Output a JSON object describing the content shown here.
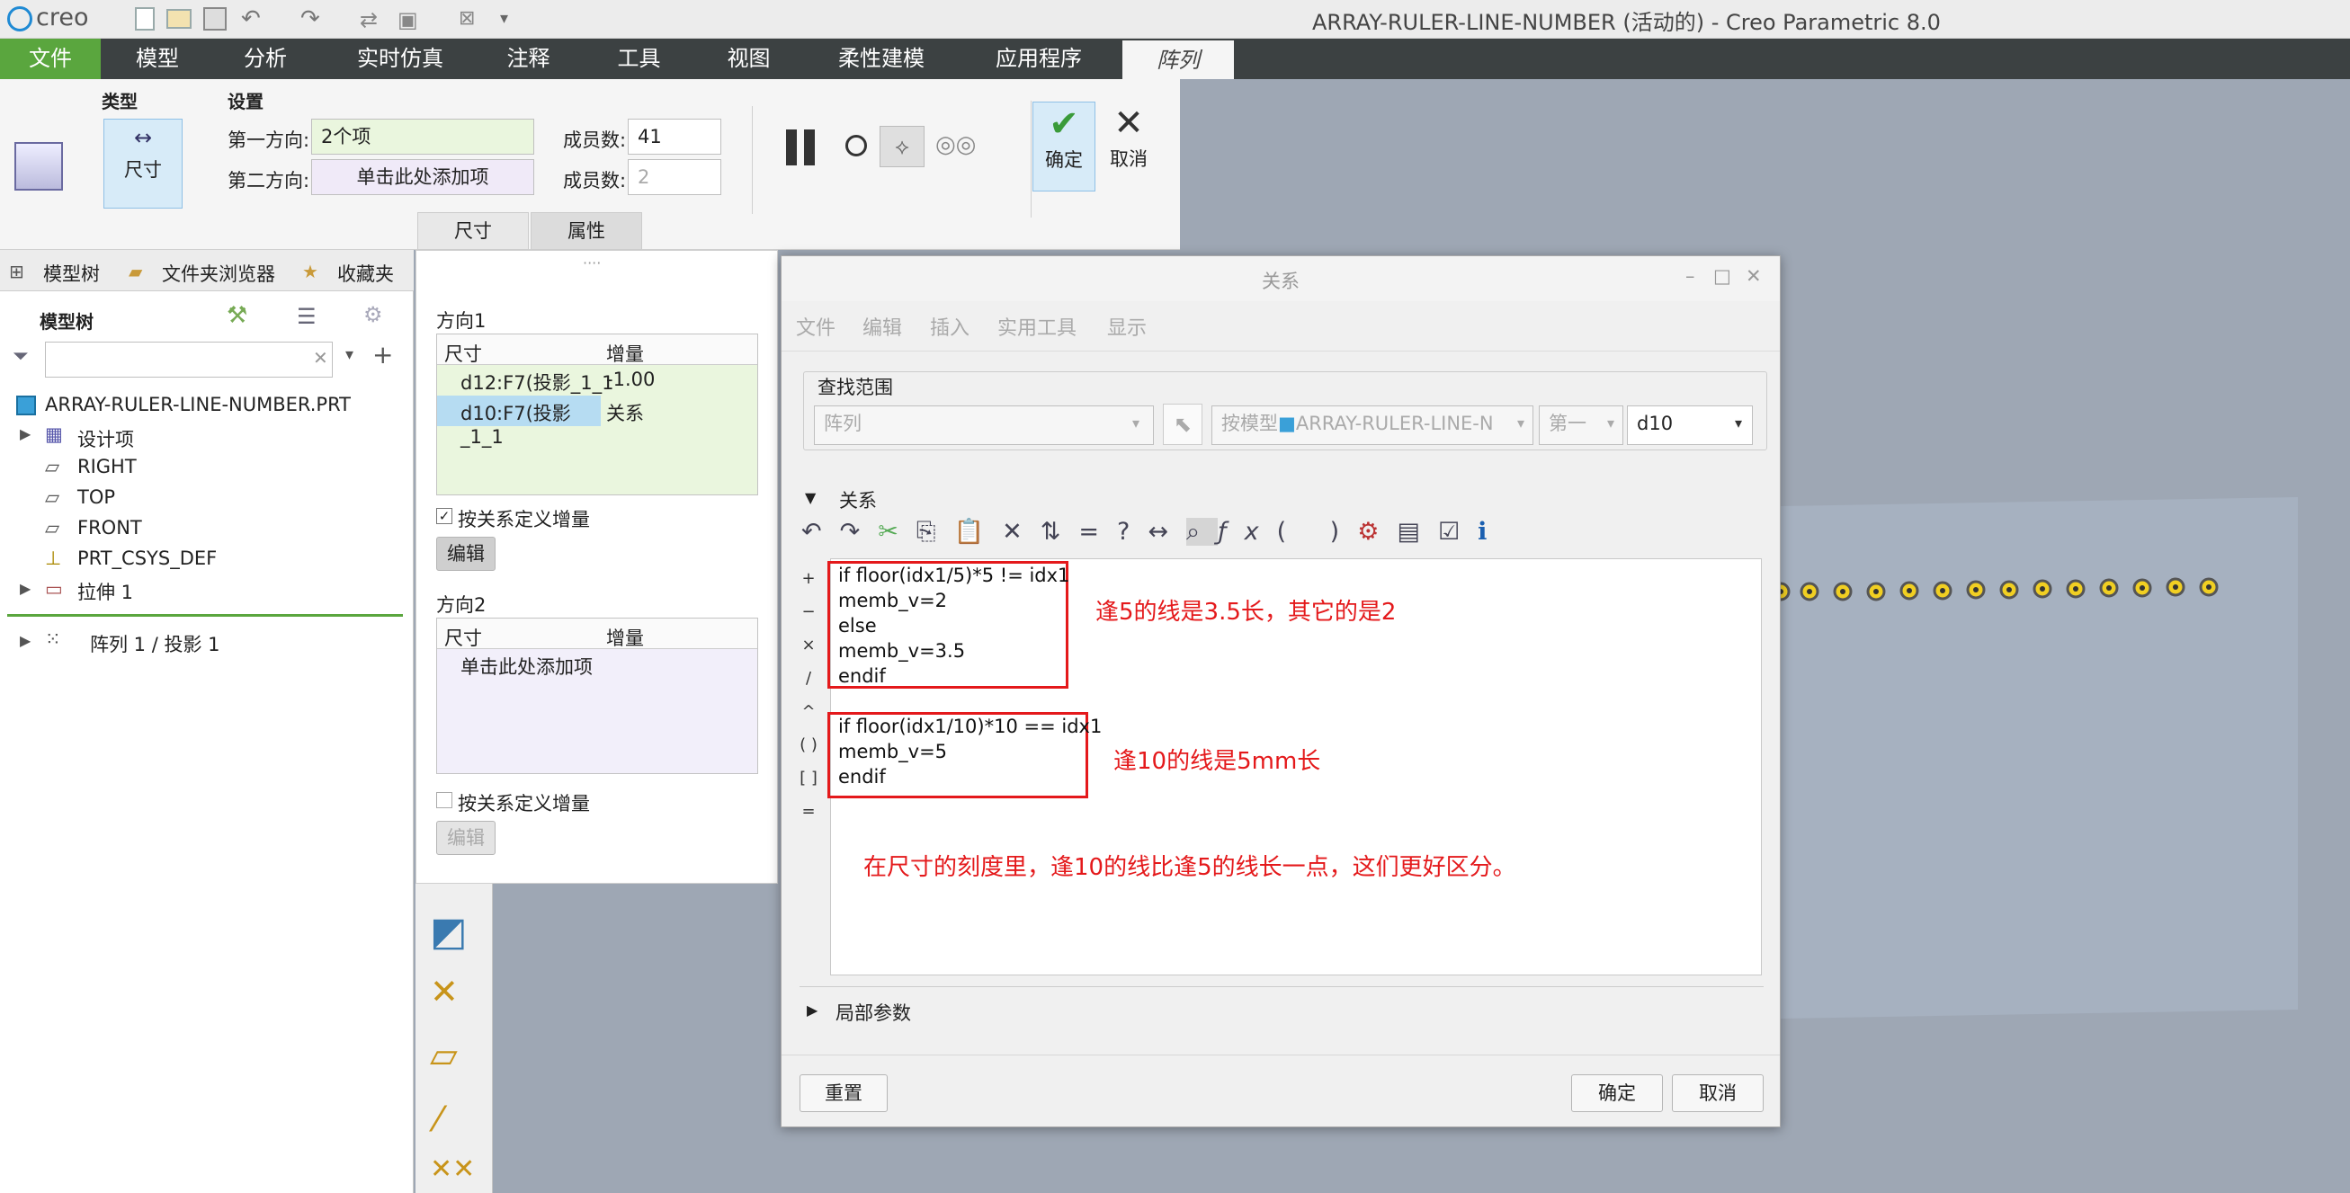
{
  "app": {
    "logo": "creo",
    "title": "ARRAY-RULER-LINE-NUMBER (活动的) - Creo Parametric 8.0"
  },
  "ribbon": {
    "tabs": [
      "文件",
      "模型",
      "分析",
      "实时仿真",
      "注释",
      "工具",
      "视图",
      "柔性建模",
      "应用程序"
    ],
    "active_tab": "阵列",
    "type_label": "类型",
    "type_btn": "尺寸",
    "settings_label": "设置",
    "dir1_label": "第一方向:",
    "dir1_value": "2个项",
    "dir2_label": "第二方向:",
    "dir2_value": "单击此处添加项",
    "members_label": "成员数:",
    "members1": "41",
    "members2": "2",
    "ok": "确定",
    "cancel": "取消",
    "subtabs": [
      "尺寸",
      "属性"
    ]
  },
  "left": {
    "tabs": [
      "模型树",
      "文件夹浏览器",
      "收藏夹"
    ],
    "header": "模型树",
    "part": "ARRAY-RULER-LINE-NUMBER.PRT",
    "items": [
      "设计项",
      "RIGHT",
      "TOP",
      "FRONT",
      "PRT_CSYS_DEF",
      "拉伸 1"
    ],
    "pattern": "阵列 1 / 投影 1"
  },
  "panel": {
    "dir1": "方向1",
    "col_dim": "尺寸",
    "col_inc": "增量",
    "rows": [
      {
        "d": "d12:F7(投影_1_1",
        "v": "-1.00"
      },
      {
        "d": "d10:F7(投影_1_1",
        "v": "关系"
      }
    ],
    "chk": "按关系定义增量",
    "edit": "编辑",
    "dir2": "方向2",
    "add": "单击此处添加项"
  },
  "dlg": {
    "title": "关系",
    "menu": [
      "文件",
      "编辑",
      "插入",
      "实用工具",
      "显示"
    ],
    "scope": "查找范围",
    "sel1": "阵列",
    "sel2": "按模型",
    "sel2b": "ARRAY-RULER-LINE-N",
    "sel3": "第一",
    "sel4": "d10",
    "section": "关系",
    "code1": [
      "if floor(idx1/5)*5 != idx1",
      "memb_v=2",
      "else",
      "memb_v=3.5",
      "endif"
    ],
    "code2": [
      "if floor(idx1/10)*10 == idx1",
      "memb_v=5",
      "endif"
    ],
    "note1": "逢5的线是3.5长，其它的是2",
    "note2": "逢10的线是5mm长",
    "note3": "在尺寸的刻度里，逢10的线比逢5的线长一点，这们更好区分。",
    "local": "局部参数",
    "reset": "重置",
    "ok": "确定",
    "cancel": "取消",
    "ops": [
      "+",
      "−",
      "×",
      "/",
      "^",
      "( )",
      "[ ]",
      "="
    ]
  },
  "colors": {
    "ribbon": "#3c4142",
    "file_tab": "#5aa63e",
    "accent": "#1a7fc0",
    "note": "#e4191b"
  }
}
